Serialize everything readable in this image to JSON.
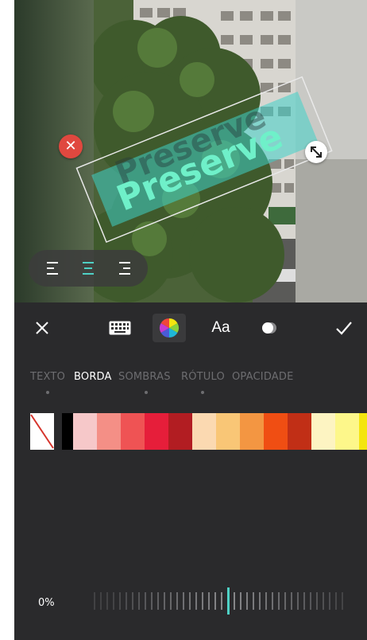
{
  "sticker": {
    "text": "Preserve"
  },
  "toolbar": {
    "close_icon": "close-icon",
    "keyboard_icon": "keyboard-icon",
    "color_icon": "color-wheel-icon",
    "font_label": "Aa",
    "style_icon": "style-icon",
    "confirm_icon": "check-icon"
  },
  "tabs": [
    {
      "label": "TEXTO",
      "active": false,
      "dot": true
    },
    {
      "label": "BORDA",
      "active": true,
      "dot": false
    },
    {
      "label": "SOMBRAS",
      "active": false,
      "dot": true
    },
    {
      "label": "RÓTULO",
      "active": false,
      "dot": true
    },
    {
      "label": "OPACIDADE",
      "active": false,
      "dot": false
    }
  ],
  "palette": {
    "colors": [
      "none",
      "#000000",
      "#f6c8c9",
      "#f48f86",
      "#ef5354",
      "#e61e3a",
      "#b21d22",
      "#fbd9b1",
      "#f9c676",
      "#f39642",
      "#f04e13",
      "#c12f16",
      "#fdf4c2",
      "#fdf78a",
      "#f4e50f"
    ]
  },
  "opacity": {
    "value_label": "0%",
    "value": 0
  },
  "colors": {
    "accent": "#4fd1c5",
    "background": "#2a2a2c",
    "delete": "#e0483f"
  }
}
